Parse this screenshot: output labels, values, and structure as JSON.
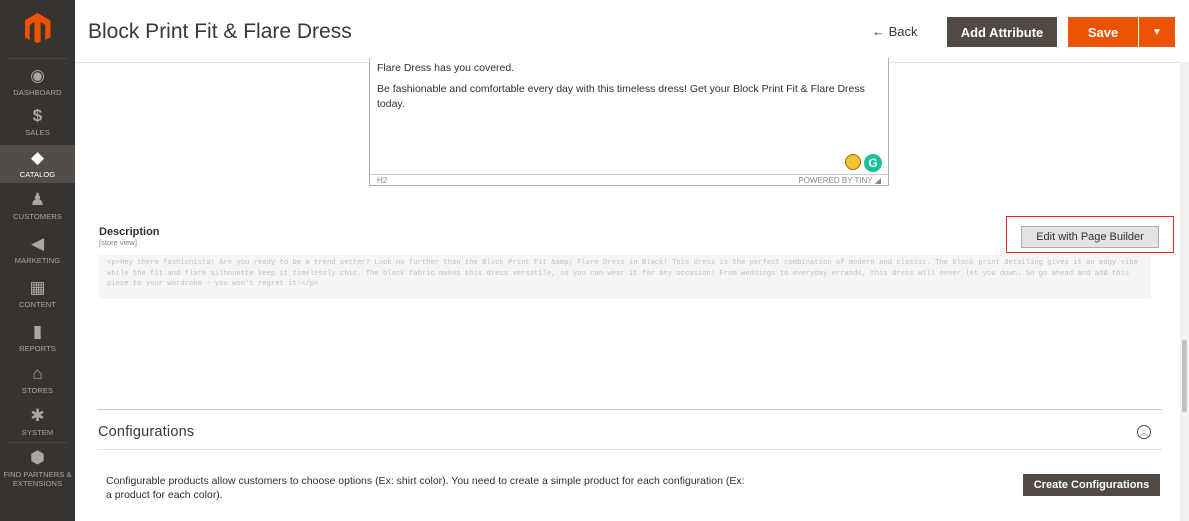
{
  "sidebar": {
    "items": [
      {
        "label": "Dashboard",
        "icon": "dashboard-icon",
        "glyph": "◉"
      },
      {
        "label": "Sales",
        "icon": "dollar-icon",
        "glyph": "$"
      },
      {
        "label": "Catalog",
        "icon": "cube-icon",
        "glyph": "◆",
        "active": true
      },
      {
        "label": "Customers",
        "icon": "person-icon",
        "glyph": "♟"
      },
      {
        "label": "Marketing",
        "icon": "megaphone-icon",
        "glyph": "◀"
      },
      {
        "label": "Content",
        "icon": "layout-icon",
        "glyph": "▦"
      },
      {
        "label": "Reports",
        "icon": "bar-chart-icon",
        "glyph": "▮"
      },
      {
        "label": "Stores",
        "icon": "store-icon",
        "glyph": "⌂"
      },
      {
        "label": "System",
        "icon": "gear-icon",
        "glyph": "✱"
      },
      {
        "label": "Find Partners & Extensions",
        "icon": "partners-icon",
        "glyph": "⬢"
      }
    ]
  },
  "header": {
    "title": "Block Print Fit & Flare Dress",
    "back_label": "← Back",
    "add_attribute_label": "Add Attribute",
    "save_label": "Save"
  },
  "editor": {
    "paragraph_1": "Flare Dress has you covered.",
    "paragraph_2": "Be fashionable and comfortable every day with this timeless dress! Get your Block Print Fit & Flare Dress today.",
    "status_path": "H2",
    "status_powered": "POWERED BY TINY"
  },
  "description": {
    "label": "Description",
    "scope": "[store view]",
    "page_builder_label": "Edit with Page Builder",
    "html_content": "<p>Hey there fashionista! Are you ready to be a trend setter? Look no further than the Block Print Fit &amp; Flare Dress in Black! This dress is the perfect combination of modern and classic. The block print detailing gives it an edgy vibe while the fit and flare silhouette keep it timelessly chic. The black fabric makes this dress versatile, so you can wear it for any occasion! From weddings to everyday errands, this dress will never let you down. So go ahead and add this piece to your wardrobe - you won't regret it!</p>"
  },
  "configurations": {
    "title": "Configurations",
    "text": "Configurable products allow customers to choose options (Ex: shirt color). You need to create a simple product for each configuration (Ex: a product for each color).",
    "create_label": "Create Configurations"
  },
  "colors": {
    "sidebar_bg": "#373330",
    "accent": "#eb5202",
    "dark_button": "#514943",
    "highlight": "#e02b27"
  }
}
